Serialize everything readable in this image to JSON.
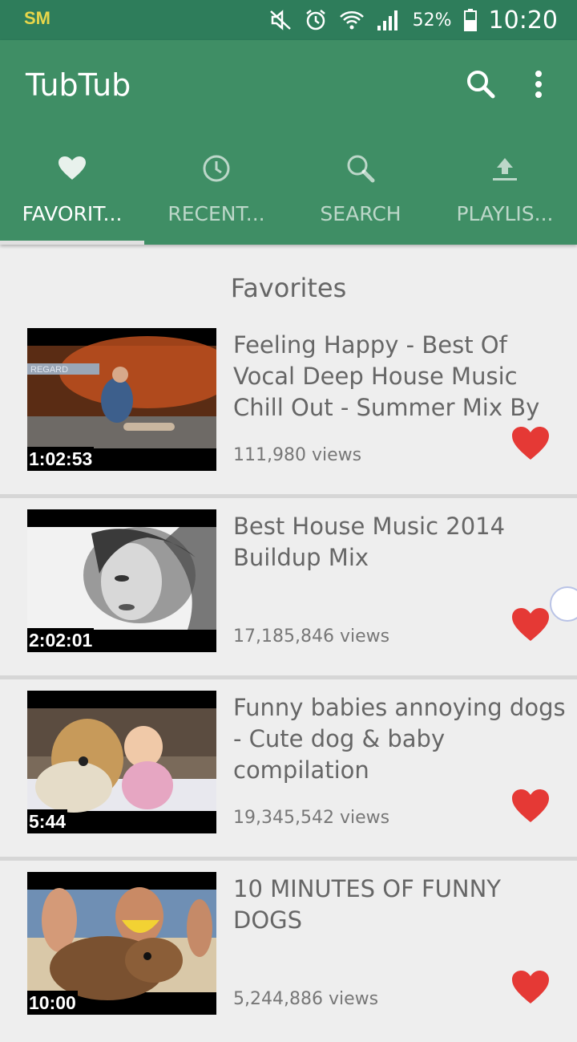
{
  "status_bar": {
    "carrier_logo": "SM",
    "battery": "52%",
    "time": "10:20",
    "icons": [
      "mute-icon",
      "alarm-icon",
      "wifi-icon",
      "signal-icon",
      "battery-icon"
    ]
  },
  "app": {
    "title": "TubTub",
    "actions": [
      "search-icon",
      "more-vert-icon"
    ]
  },
  "tabs": [
    {
      "label": "FAVORIT...",
      "icon": "heart-icon",
      "active": true
    },
    {
      "label": "RECENT...",
      "icon": "clock-icon",
      "active": false
    },
    {
      "label": "SEARCH",
      "icon": "search-icon",
      "active": false
    },
    {
      "label": "PLAYLIS...",
      "icon": "upload-icon",
      "active": false
    }
  ],
  "section_title": "Favorites",
  "videos": [
    {
      "title": "Feeling Happy - Best Of Vocal Deep House Music Chill Out - Summer Mix By",
      "views": "111,980 views",
      "duration": "1:02:53",
      "thumb_label": "REGARD",
      "favorite": true
    },
    {
      "title": "Best House Music 2014 Buildup Mix",
      "views": "17,185,846 views",
      "duration": "2:02:01",
      "favorite": true
    },
    {
      "title": "Funny babies annoying dogs - Cute dog & baby compilation",
      "views": "19,345,542 views",
      "duration": "5:44",
      "favorite": true
    },
    {
      "title": "10 MINUTES OF FUNNY DOGS",
      "views": "5,244,886 views",
      "duration": "10:00",
      "favorite": true
    }
  ],
  "colors": {
    "status_bar": "#2e7d5b",
    "app_bar": "#3f8e65",
    "heart": "#e53935",
    "background": "#eeeeee"
  }
}
